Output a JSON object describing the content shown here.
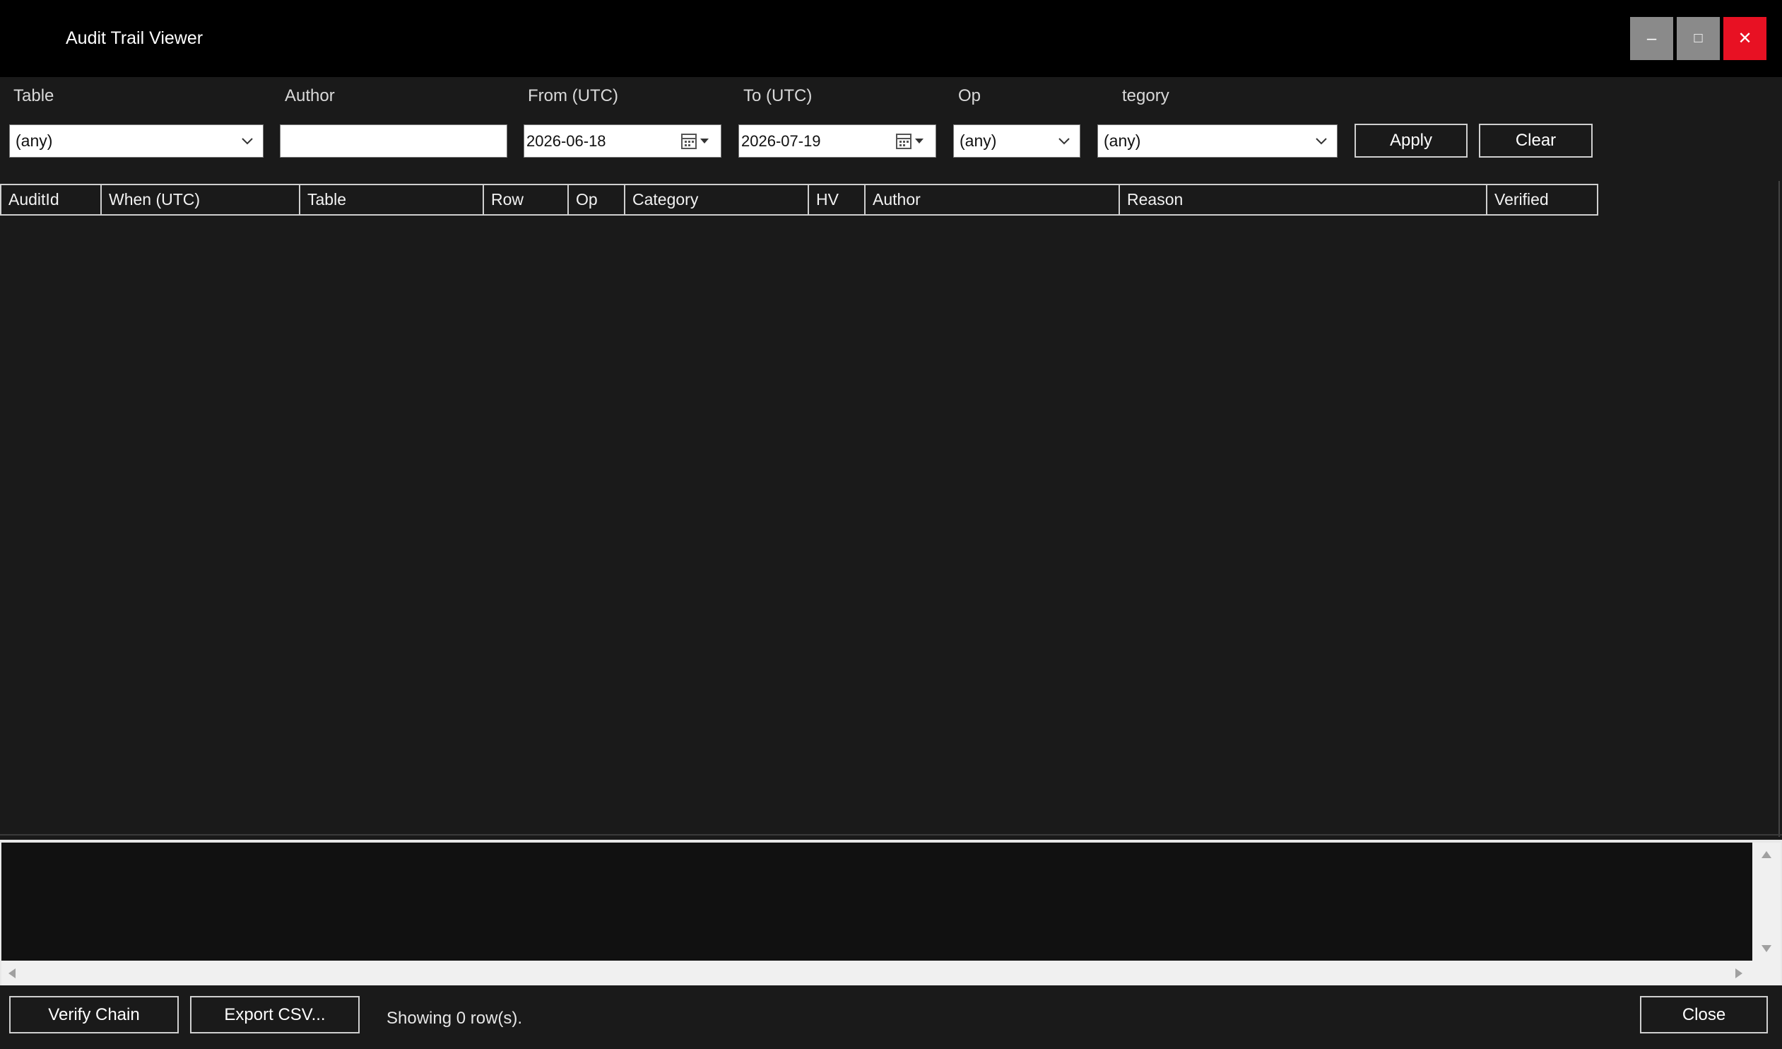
{
  "window": {
    "title": "Audit Trail Viewer",
    "minimize_glyph": "–",
    "maximize_glyph": "□",
    "close_glyph": "✕"
  },
  "filters": {
    "table_label": "Table",
    "table_value": "(any)",
    "author_label": "Author",
    "author_value": "",
    "from_label": "From (UTC)",
    "from_value": "2026-06-18",
    "to_label": "To (UTC)",
    "to_value": "2026-07-19",
    "op_label": "Op",
    "op_value": "(any)",
    "category_label": "tegory",
    "category_value": "(any)",
    "apply_label": "Apply",
    "clear_label": "Clear"
  },
  "grid": {
    "columns": [
      "AuditId",
      "When (UTC)",
      "Table",
      "Row",
      "Op",
      "Category",
      "HV",
      "Author",
      "Reason",
      "Verified"
    ],
    "rows": []
  },
  "detail": {
    "text": ""
  },
  "footer": {
    "verify_label": "Verify Chain",
    "export_label": "Export CSV...",
    "status": "Showing 0 row(s).",
    "close_label": "Close"
  },
  "colors": {
    "window_bg": "#1a1a1a",
    "titlebar_bg": "#000000",
    "close_button": "#e81123",
    "control_button": "#8a8a8a"
  }
}
